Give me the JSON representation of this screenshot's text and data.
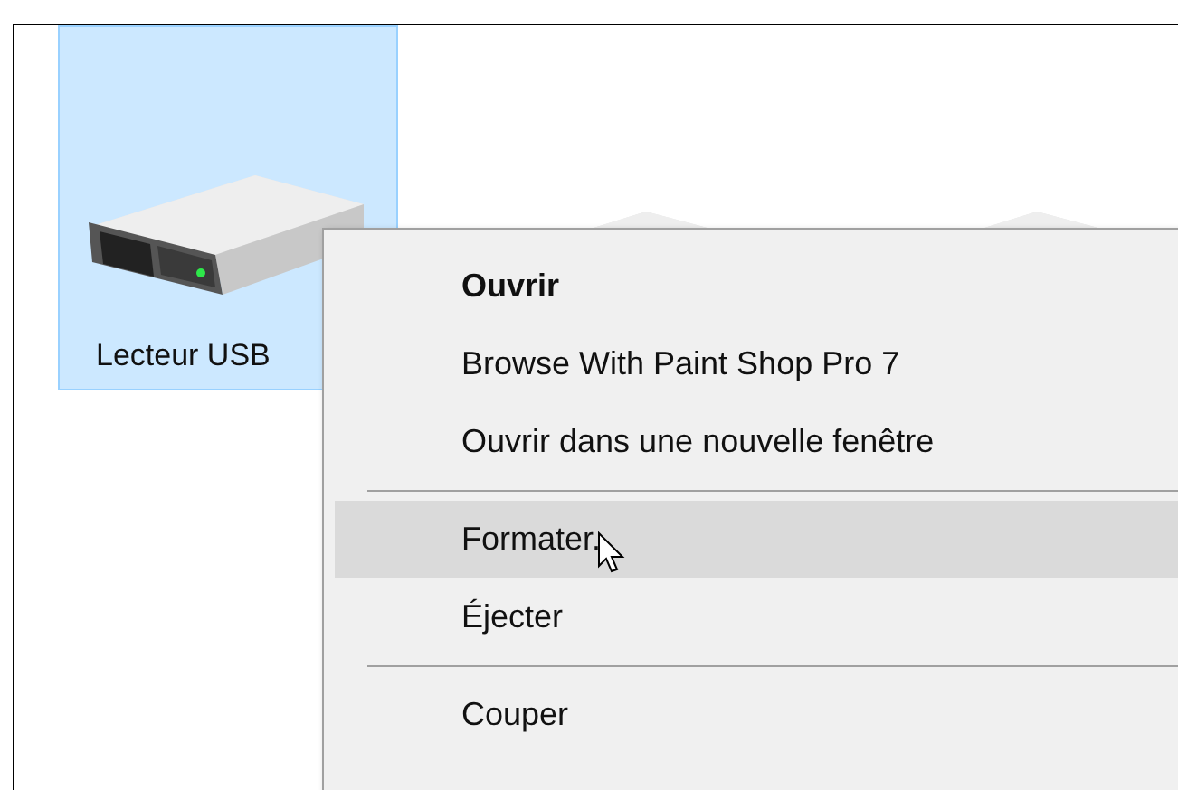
{
  "drives": [
    {
      "label": "Lecteur USB",
      "selected": true
    },
    {
      "selected": false
    },
    {
      "selected": false
    }
  ],
  "context_menu": {
    "items": [
      {
        "kind": "item",
        "label": "Ouvrir",
        "default": true,
        "selected": false
      },
      {
        "kind": "item",
        "label": "Browse With Paint Shop Pro 7",
        "default": false,
        "selected": false
      },
      {
        "kind": "item",
        "label": "Ouvrir dans une nouvelle fenêtre",
        "default": false,
        "selected": false
      },
      {
        "kind": "separator"
      },
      {
        "kind": "item",
        "label": "Formater.",
        "default": false,
        "selected": true
      },
      {
        "kind": "item",
        "label": "Éjecter",
        "default": false,
        "selected": false
      },
      {
        "kind": "separator"
      },
      {
        "kind": "item",
        "label": "Couper",
        "default": false,
        "selected": false
      }
    ]
  }
}
